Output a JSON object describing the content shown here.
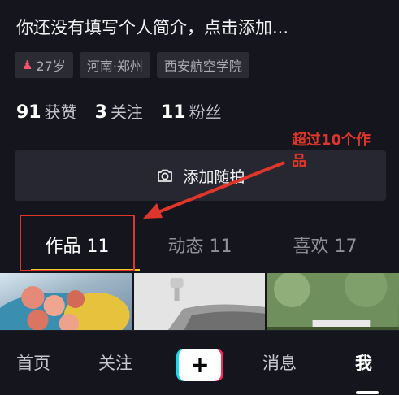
{
  "profile": {
    "bio": "你还没有填写个人简介，点击添加...",
    "tags": [
      {
        "label": "27岁",
        "icon": "female-icon",
        "icon_color": "#f2556d"
      },
      {
        "label": "河南·郑州"
      },
      {
        "label": "西安航空学院"
      }
    ],
    "stats": [
      {
        "num": "91",
        "label": "获赞"
      },
      {
        "num": "3",
        "label": "关注"
      },
      {
        "num": "11",
        "label": "粉丝"
      }
    ]
  },
  "add_button": {
    "label": "添加随拍",
    "icon": "camera-icon"
  },
  "annotation": {
    "text": "超过10个作品",
    "color": "#e0352b"
  },
  "tabs": [
    {
      "label": "作品 11",
      "active": true
    },
    {
      "label": "动态 11"
    },
    {
      "label": "喜欢 17"
    }
  ],
  "tab_underline_color": "#f4c930",
  "bottom_nav": {
    "home": "首页",
    "follow": "关注",
    "publish_symbol": "+",
    "messages": "消息",
    "me": "我"
  }
}
